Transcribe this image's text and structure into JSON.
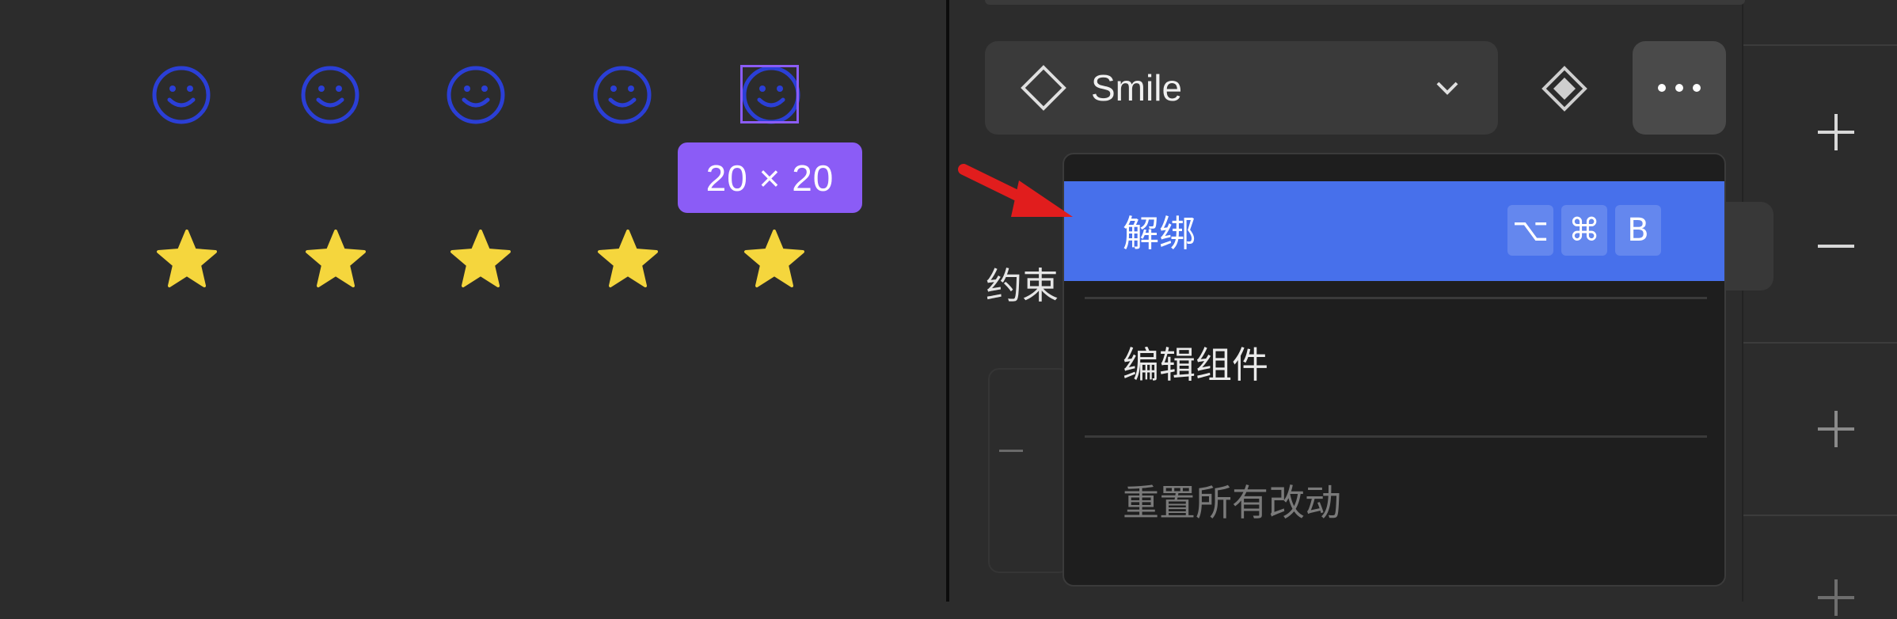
{
  "canvas": {
    "selection_size": "20 × 20",
    "icon_rows": [
      {
        "name": "smile-icon",
        "count": 5,
        "color": "#2b3fd6"
      },
      {
        "name": "star-icon",
        "count": 5,
        "color": "#f5d63d"
      }
    ],
    "selection_color": "#8b5cf6"
  },
  "inspector": {
    "component_name": "Smile",
    "constraints_label": "约束"
  },
  "context_menu": {
    "items": [
      {
        "label": "解绑",
        "shortcut": [
          "⌥",
          "⌘",
          "B"
        ],
        "highlighted": true,
        "enabled": true
      },
      {
        "label": "编辑组件",
        "enabled": true
      },
      {
        "label": "重置所有改动",
        "enabled": false
      }
    ],
    "highlight_color": "#4770eb"
  },
  "annotation": {
    "arrow_color": "#e11d1d"
  },
  "icons": {
    "component": "diamond-outline-icon",
    "main_component": "diamond-filled-icon",
    "dropdown": "chevron-down-icon",
    "more": "ellipsis-icon",
    "side": [
      "plus-icon",
      "minus-icon",
      "plus-icon",
      "plus-icon"
    ]
  }
}
